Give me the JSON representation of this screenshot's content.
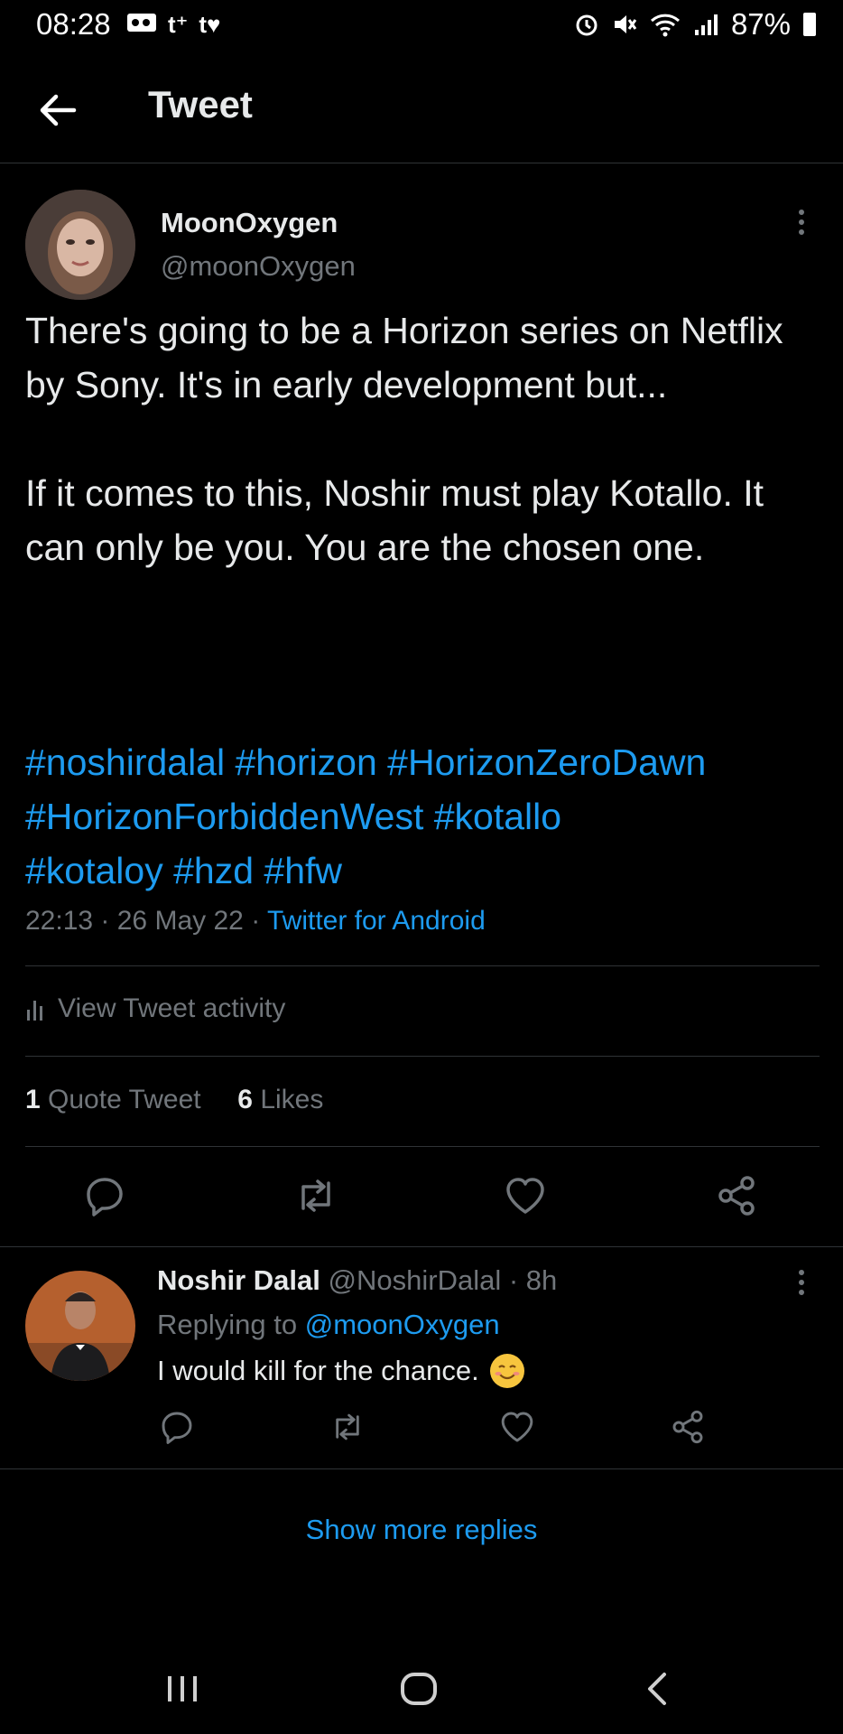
{
  "status_bar": {
    "time": "08:28",
    "notif_icons": [
      "voicemail-icon",
      "t-plus-icon",
      "t-heart-icon"
    ],
    "battery": "87%"
  },
  "header": {
    "title": "Tweet"
  },
  "tweet": {
    "author_name": "MoonOxygen",
    "author_handle": "@moonOxygen",
    "text": "There's going to be a Horizon series on Netflix by Sony. It's in early development but...\n\nIf it comes to this, Noshir must play Kotallo. It can only be you. You are the chosen one.",
    "hashtags_line1": "#noshirdalal #horizon #HorizonZeroDawn",
    "hashtags_line2": "#HorizonForbiddenWest #kotallo",
    "hashtags_line3": "#kotaloy #hzd #hfw",
    "time": "22:13",
    "date": "26 May 22",
    "source": "Twitter for Android",
    "activity_label": "View Tweet activity",
    "quote_count": "1",
    "quote_label": "Quote Tweet",
    "like_count": "6",
    "like_label": "Likes"
  },
  "reply": {
    "author_name": "Noshir Dalal",
    "author_handle": "@NoshirDalal",
    "age": "8h",
    "replying_prefix": "Replying to",
    "replying_handle": "@moonOxygen",
    "text": "I would kill for the chance."
  },
  "show_more": "Show more replies",
  "colors": {
    "accent": "#1d9bf0",
    "muted": "#71767b",
    "text": "#e7e9ea",
    "background": "#000000"
  }
}
